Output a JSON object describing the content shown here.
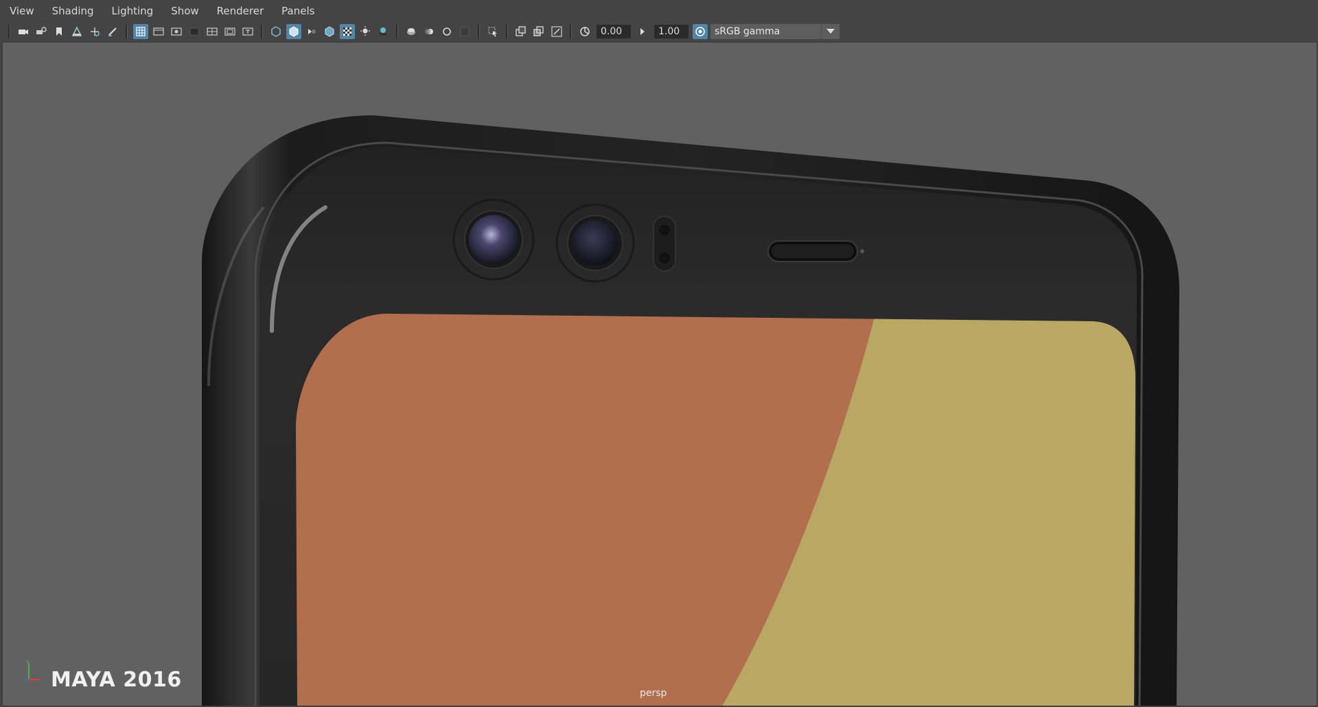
{
  "menubar": {
    "items": [
      {
        "label": "View"
      },
      {
        "label": "Shading"
      },
      {
        "label": "Lighting"
      },
      {
        "label": "Show"
      },
      {
        "label": "Renderer"
      },
      {
        "label": "Panels"
      }
    ]
  },
  "toolbar": {
    "exposure_value": "0.00",
    "gamma_value": "1.00",
    "color_space": "sRGB gamma",
    "icons": [
      "camera-icon",
      "camera-attributes-icon",
      "bookmark-icon",
      "image-plane-icon",
      "2d-pan-zoom-icon",
      "grease-pencil-icon",
      "grid-icon",
      "film-gate-icon",
      "resolution-gate-icon",
      "gate-mask-icon",
      "field-chart-icon",
      "safe-action-icon",
      "safe-title-icon",
      "wireframe-icon",
      "smooth-shade-icon",
      "use-default-material-icon",
      "wireframe-on-shaded-icon",
      "textured-icon",
      "lights-icon",
      "shadows-icon",
      "screen-space-ao-icon",
      "motion-blur-icon",
      "anti-aliasing-icon",
      "depth-of-field-icon",
      "isolate-select-icon",
      "xray-icon",
      "xray-active-icon",
      "xray-joints-icon",
      "exposure-icon",
      "gamma-icon",
      "color-management-icon"
    ]
  },
  "viewport": {
    "background_color": "#616161",
    "camera_label": "persp",
    "watermark": "MAYA 2016",
    "colors": {
      "phone_body": "#1e1e1e",
      "screen_left": "#b26f4e",
      "screen_right": "#b9a863"
    }
  }
}
